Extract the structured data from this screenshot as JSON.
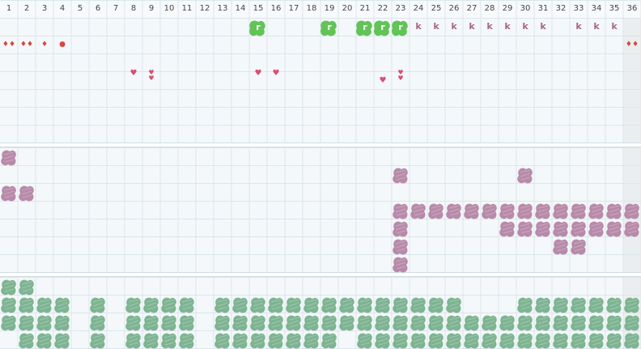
{
  "columns": [
    "1",
    "2",
    "3",
    "4",
    "5",
    "6",
    "7",
    "8",
    "9",
    "10",
    "11",
    "12",
    "13",
    "14",
    "15",
    "16",
    "17",
    "18",
    "19",
    "20",
    "21",
    "22",
    "23",
    "24",
    "25",
    "26",
    "27",
    "28",
    "29",
    "30",
    "31",
    "32",
    "33",
    "34",
    "35",
    "36"
  ],
  "colors": {
    "purple": "#b88aaa",
    "green": "#7eb491",
    "light_green": "#62c357",
    "k_color": "#a7678a",
    "drop": "#d9463b",
    "heart": "#d94f73",
    "grid_line": "#dbe6ec",
    "highlight_column": "#ebeeef"
  },
  "icons": {
    "r_badge": "r-icon",
    "k_badge": "k-icon",
    "drop": "drop-icon",
    "heart": "heart-icon"
  },
  "r_label": "r",
  "k_label": "k",
  "top_marks": {
    "r_cols": [
      15,
      19,
      21,
      22,
      23
    ],
    "k_cols": [
      24,
      25,
      26,
      27,
      28,
      29,
      30,
      31,
      33,
      34,
      35
    ],
    "drops": [
      {
        "col": 1,
        "count": 2
      },
      {
        "col": 2,
        "count": 2
      },
      {
        "col": 3,
        "count": 1
      },
      {
        "col": 4,
        "count": 1,
        "round": true
      },
      {
        "col": 36,
        "count": 2
      }
    ],
    "hearts": [
      {
        "col": 8,
        "count": 1,
        "row": 4
      },
      {
        "col": 9,
        "count": 2,
        "row": 4
      },
      {
        "col": 15,
        "count": 1,
        "row": 4
      },
      {
        "col": 16,
        "count": 1,
        "row": 4
      },
      {
        "col": 22,
        "count": 1,
        "row": 4.4
      },
      {
        "col": 23,
        "count": 2,
        "row": 4
      }
    ]
  },
  "purple_rows": [
    [
      1
    ],
    [
      23,
      30
    ],
    [
      1,
      2
    ],
    [
      23,
      24,
      25,
      26,
      27,
      28,
      29,
      30,
      31,
      32,
      33,
      34,
      35,
      36
    ],
    [
      23,
      29,
      30,
      31,
      32,
      33,
      34,
      35,
      36
    ],
    [
      23,
      32,
      33
    ],
    [
      23
    ]
  ],
  "green_rows": [
    [
      1,
      2
    ],
    [
      1,
      2,
      3,
      4,
      6,
      8,
      9,
      10,
      11,
      13,
      14,
      15,
      16,
      17,
      18,
      19,
      20,
      21,
      22,
      23,
      24,
      25,
      26,
      30,
      31,
      32,
      33,
      34,
      35,
      36
    ],
    [
      1,
      2,
      3,
      4,
      6,
      8,
      9,
      10,
      11,
      13,
      14,
      15,
      16,
      17,
      18,
      19,
      20,
      21,
      22,
      23,
      24,
      25,
      26,
      27,
      28,
      29,
      30,
      31,
      32,
      33,
      34,
      35,
      36
    ],
    [
      2,
      3,
      4,
      6,
      8,
      9,
      10,
      11,
      13,
      14,
      15,
      16,
      17,
      18,
      19,
      21,
      22,
      23,
      24,
      25,
      26,
      27,
      28,
      29,
      30,
      31,
      32,
      33,
      34,
      35,
      36
    ]
  ]
}
